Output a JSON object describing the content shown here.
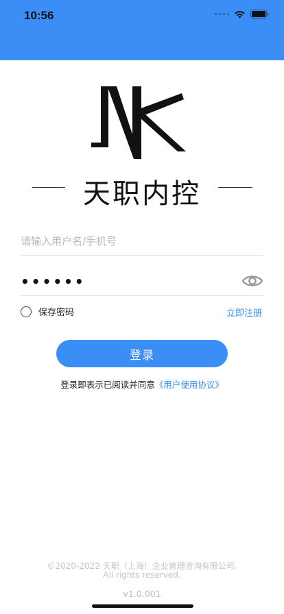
{
  "status_bar": {
    "time": "10:56",
    "background_color": "#3a8ef6",
    "icons": [
      "cellular-dots-icon",
      "wifi-icon",
      "battery-icon"
    ]
  },
  "brand": {
    "logo_icon": "nk-logo-icon",
    "logo_letters": "NK",
    "name": "天职内控"
  },
  "login_form": {
    "username_placeholder": "请输入用户名/手机号",
    "password_value": "••••••",
    "show_password_icon": "eye-icon",
    "remember_label": "保存密码",
    "remember_checked": false,
    "register_link": "立即注册",
    "submit_label": "登录",
    "accent_color": "#3a8ef6"
  },
  "agreement": {
    "prefix": "登录即表示已阅读并同意",
    "link": "《用户使用协议》"
  },
  "footer": {
    "copyright": "©2020-2022 天职（上海）企业管理咨询有限公司.",
    "rights": "All rights reserved.",
    "version": "v1.0.001"
  }
}
